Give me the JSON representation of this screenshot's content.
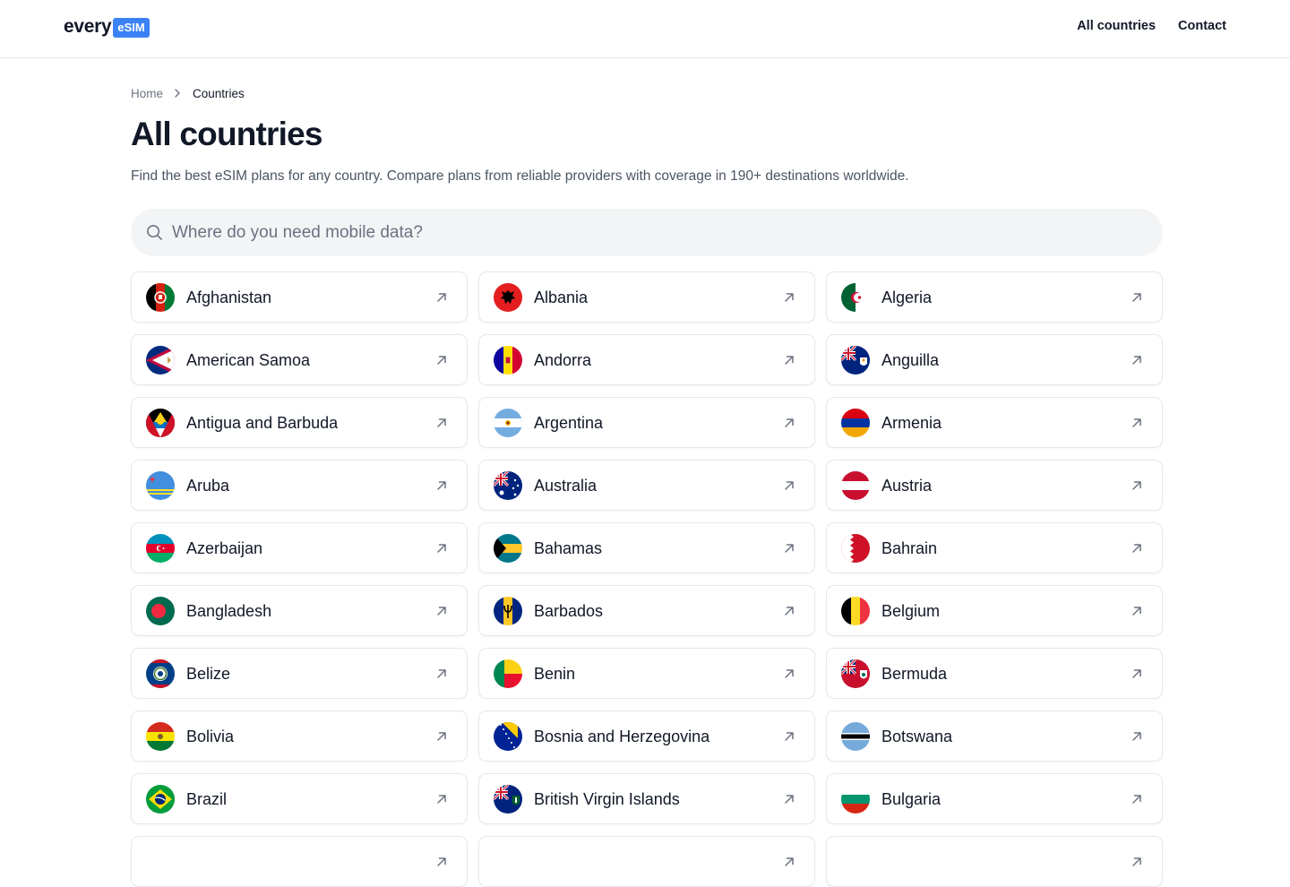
{
  "header": {
    "logo_text": "every",
    "logo_badge": "eSIM",
    "brand_color": "#3b82f6",
    "nav": [
      "All countries",
      "Contact"
    ]
  },
  "breadcrumb": {
    "home": "Home",
    "separator_icon": "chevron-right-icon",
    "current": "Countries"
  },
  "page": {
    "title": "All countries",
    "subtitle": "Find the best eSIM plans for any country. Compare plans from reliable providers with coverage in 190+ destinations worldwide."
  },
  "search": {
    "placeholder": "Where do you need mobile data?",
    "value": "",
    "icon": "search-icon"
  },
  "countries": [
    {
      "name": "Afghanistan",
      "flag": "afghanistan-flag-icon"
    },
    {
      "name": "Albania",
      "flag": "albania-flag-icon"
    },
    {
      "name": "Algeria",
      "flag": "algeria-flag-icon"
    },
    {
      "name": "American Samoa",
      "flag": "american-samoa-flag-icon"
    },
    {
      "name": "Andorra",
      "flag": "andorra-flag-icon"
    },
    {
      "name": "Anguilla",
      "flag": "anguilla-flag-icon"
    },
    {
      "name": "Antigua and Barbuda",
      "flag": "antigua-flag-icon"
    },
    {
      "name": "Argentina",
      "flag": "argentina-flag-icon"
    },
    {
      "name": "Armenia",
      "flag": "armenia-flag-icon"
    },
    {
      "name": "Aruba",
      "flag": "aruba-flag-icon"
    },
    {
      "name": "Australia",
      "flag": "australia-flag-icon"
    },
    {
      "name": "Austria",
      "flag": "austria-flag-icon"
    },
    {
      "name": "Azerbaijan",
      "flag": "azerbaijan-flag-icon"
    },
    {
      "name": "Bahamas",
      "flag": "bahamas-flag-icon"
    },
    {
      "name": "Bahrain",
      "flag": "bahrain-flag-icon"
    },
    {
      "name": "Bangladesh",
      "flag": "bangladesh-flag-icon"
    },
    {
      "name": "Barbados",
      "flag": "barbados-flag-icon"
    },
    {
      "name": "Belgium",
      "flag": "belgium-flag-icon"
    },
    {
      "name": "Belize",
      "flag": "belize-flag-icon"
    },
    {
      "name": "Benin",
      "flag": "benin-flag-icon"
    },
    {
      "name": "Bermuda",
      "flag": "bermuda-flag-icon"
    },
    {
      "name": "Bolivia",
      "flag": "bolivia-flag-icon"
    },
    {
      "name": "Bosnia and Herzegovina",
      "flag": "bosnia-flag-icon"
    },
    {
      "name": "Botswana",
      "flag": "botswana-flag-icon"
    },
    {
      "name": "Brazil",
      "flag": "brazil-flag-icon"
    },
    {
      "name": "British Virgin Islands",
      "flag": "bvi-flag-icon"
    },
    {
      "name": "Bulgaria",
      "flag": "bulgaria-flag-icon"
    },
    {
      "name": "",
      "flag": ""
    },
    {
      "name": "",
      "flag": ""
    },
    {
      "name": "",
      "flag": ""
    }
  ],
  "card_arrow_icon": "arrow-up-right-icon"
}
